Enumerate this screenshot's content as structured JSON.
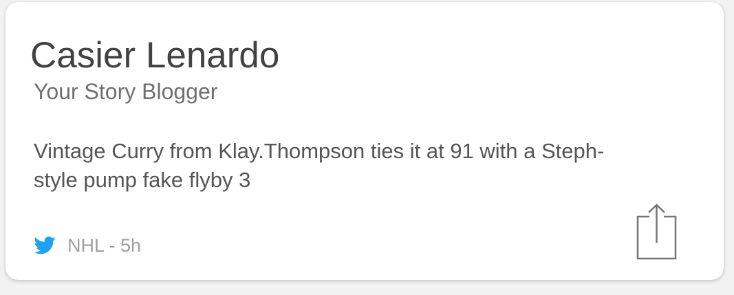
{
  "card": {
    "author_name": "Casier Lenardo",
    "author_role": "Your Story Blogger",
    "post_text": "Vintage Curry from Klay.Thompson ties it at 91 with a Steph-style pump fake flyby 3",
    "source": {
      "icon": "twitter-bird-icon",
      "label": "NHL - 5h"
    },
    "share": {
      "icon": "share-icon"
    }
  },
  "colors": {
    "twitter": "#1da1f2",
    "name_text": "#424242",
    "body_text": "#555555",
    "meta_text": "#9e9e9e",
    "share_icon": "#757575"
  }
}
